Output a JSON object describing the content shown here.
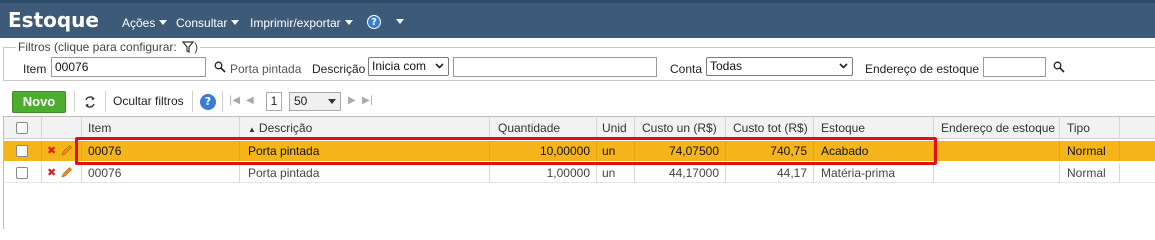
{
  "app": {
    "title": "Estoque",
    "menus": [
      {
        "label": "Ações"
      },
      {
        "label": "Consultar"
      },
      {
        "label": "Imprimir/exportar"
      }
    ]
  },
  "filters": {
    "legend": "Filtros (clique para configurar:",
    "item_label": "Item",
    "item_value": "00076",
    "item_desc": "Porta pintada",
    "descricao_label": "Descrição",
    "descricao_mode": "Inicia com",
    "descricao_value": "",
    "conta_label": "Conta",
    "conta_value": "Todas",
    "endereco_label": "Endereço de estoque",
    "endereco_value": ""
  },
  "toolbar": {
    "novo_label": "Novo",
    "ocultar_label": "Ocultar filtros",
    "page_number": "1",
    "page_size": "50"
  },
  "grid": {
    "columns": [
      "Item",
      "Descrição",
      "Quantidade",
      "Unid",
      "Custo un (R$)",
      "Custo tot (R$)",
      "Estoque",
      "Endereço de estoque",
      "Tipo"
    ],
    "sort_column": "Descrição",
    "rows": [
      {
        "item": "00076",
        "descricao": "Porta pintada",
        "quantidade": "10,00000",
        "unid": "un",
        "custo_un": "74,07500",
        "custo_tot": "740,75",
        "estoque": "Acabado",
        "endereco": "",
        "tipo": "Normal",
        "selected": true
      },
      {
        "item": "00076",
        "descricao": "Porta pintada",
        "quantidade": "1,00000",
        "unid": "un",
        "custo_un": "44,17000",
        "custo_tot": "44,17",
        "estoque": "Matéria-prima",
        "endereco": "",
        "tipo": "Normal",
        "selected": false
      }
    ]
  },
  "colors": {
    "topbar": "#3d5a78",
    "selected_row": "#f4b41a",
    "novo_button": "#4cae2e",
    "highlight_border": "#e01010"
  }
}
